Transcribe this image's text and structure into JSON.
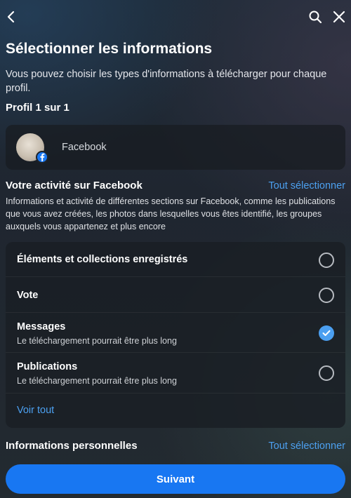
{
  "header": {
    "back_icon": "chevron-left-icon",
    "search_icon": "search-icon",
    "close_icon": "close-icon"
  },
  "page": {
    "title": "Sélectionner les informations",
    "description": "Vous pouvez choisir les types d'informations à télécharger pour chaque profil.",
    "profile_count": "Profil 1 sur 1"
  },
  "profile": {
    "name": "Facebook",
    "badge_icon": "facebook-icon"
  },
  "activity_section": {
    "title": "Votre activité sur Facebook",
    "select_all": "Tout sélectionner",
    "description": "Informations et activité de différentes sections sur Facebook, comme les publications que vous avez créées, les photos dans lesquelles vous êtes identifié, les groupes auxquels vous appartenez et plus encore",
    "options": [
      {
        "label": "Éléments et collections enregistrés",
        "sublabel": "",
        "checked": false
      },
      {
        "label": "Vote",
        "sublabel": "",
        "checked": false
      },
      {
        "label": "Messages",
        "sublabel": "Le téléchargement pourrait être plus long",
        "checked": true
      },
      {
        "label": "Publications",
        "sublabel": "Le téléchargement pourrait être plus long",
        "checked": false
      }
    ],
    "see_all": "Voir tout"
  },
  "personal_section": {
    "title": "Informations personnelles",
    "select_all": "Tout sélectionner"
  },
  "footer": {
    "next_label": "Suivant"
  },
  "colors": {
    "accent": "#1877f2",
    "link": "#4ca0f0",
    "checked": "#4b9ff0"
  }
}
